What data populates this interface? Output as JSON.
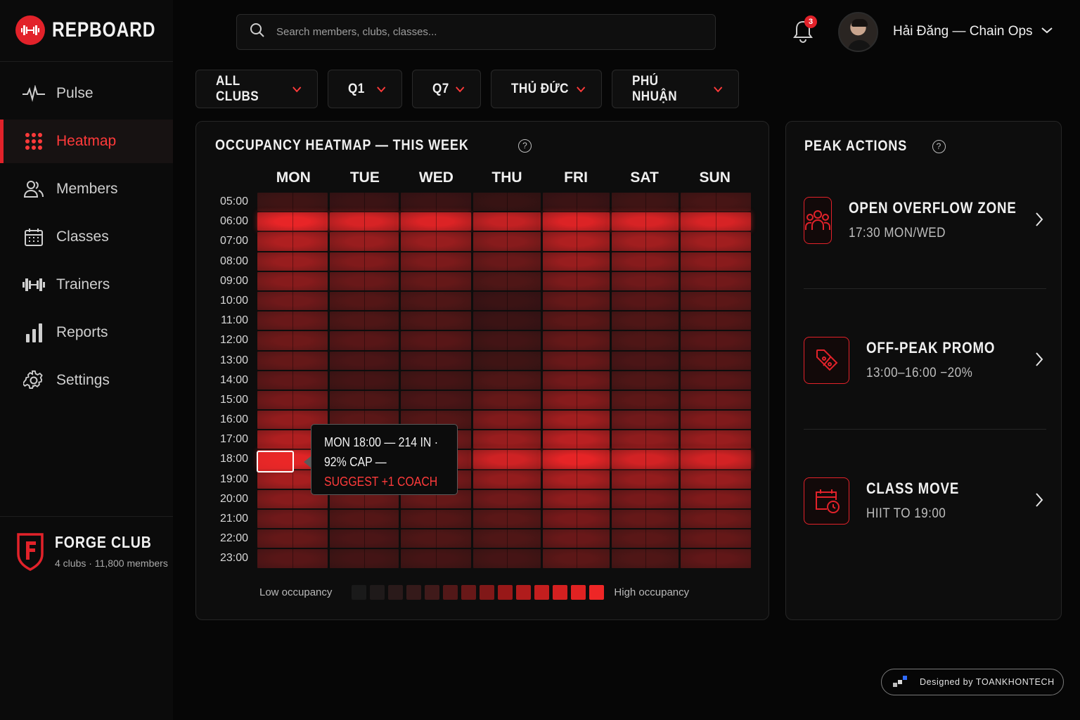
{
  "app": {
    "name": "REPBOARD",
    "logo_icon": "dumbbell-icon",
    "accent_color": "#e2222a"
  },
  "search": {
    "placeholder": "Search members, clubs, classes..."
  },
  "notifications": {
    "count": "3",
    "icon": "bell-icon"
  },
  "user": {
    "name": "Hải Đăng — Chain Ops"
  },
  "sidebar": {
    "items": [
      {
        "label": "Pulse",
        "icon": "pulse-icon",
        "active": false
      },
      {
        "label": "Heatmap",
        "icon": "grid-dots-icon",
        "active": true
      },
      {
        "label": "Members",
        "icon": "users-icon",
        "active": false
      },
      {
        "label": "Classes",
        "icon": "calendar-icon",
        "active": false
      },
      {
        "label": "Trainers",
        "icon": "dumbbell-icon",
        "active": false
      },
      {
        "label": "Reports",
        "icon": "bar-chart-icon",
        "active": false
      },
      {
        "label": "Settings",
        "icon": "gear-icon",
        "active": false
      }
    ],
    "club": {
      "name": "FORGE CLUB",
      "sub": "4 clubs · 11,800 members",
      "icon": "shield-f-icon"
    }
  },
  "filters": [
    {
      "label": "ALL CLUBS"
    },
    {
      "label": "Q1"
    },
    {
      "label": "Q7"
    },
    {
      "label": "THỦ ĐỨC"
    },
    {
      "label": "PHÚ NHUẬN"
    }
  ],
  "heatmap": {
    "title": "OCCUPANCY HEATMAP — THIS WEEK",
    "days": [
      "MON",
      "TUE",
      "WED",
      "THU",
      "FRI",
      "SAT",
      "SUN"
    ],
    "hours": [
      "05:00",
      "06:00",
      "07:00",
      "08:00",
      "09:00",
      "10:00",
      "11:00",
      "12:00",
      "13:00",
      "14:00",
      "15:00",
      "16:00",
      "17:00",
      "18:00",
      "19:00",
      "20:00",
      "21:00",
      "22:00",
      "23:00"
    ],
    "occupancy": [
      [
        0.22,
        0.95,
        0.72,
        0.62,
        0.55,
        0.45,
        0.42,
        0.44,
        0.4,
        0.38,
        0.48,
        0.6,
        0.72,
        0.92,
        0.68,
        0.55,
        0.45,
        0.4,
        0.34
      ],
      [
        0.2,
        0.88,
        0.62,
        0.52,
        0.42,
        0.32,
        0.3,
        0.34,
        0.28,
        0.25,
        0.3,
        0.35,
        0.48,
        0.62,
        0.5,
        0.4,
        0.32,
        0.28,
        0.24
      ],
      [
        0.2,
        0.9,
        0.62,
        0.5,
        0.4,
        0.3,
        0.3,
        0.34,
        0.28,
        0.25,
        0.28,
        0.32,
        0.45,
        0.6,
        0.48,
        0.4,
        0.32,
        0.3,
        0.25
      ],
      [
        0.18,
        0.8,
        0.55,
        0.42,
        0.3,
        0.2,
        0.2,
        0.24,
        0.22,
        0.3,
        0.4,
        0.52,
        0.62,
        0.85,
        0.6,
        0.45,
        0.35,
        0.3,
        0.25
      ],
      [
        0.2,
        0.9,
        0.72,
        0.62,
        0.5,
        0.4,
        0.36,
        0.4,
        0.42,
        0.46,
        0.55,
        0.66,
        0.76,
        0.94,
        0.7,
        0.58,
        0.48,
        0.42,
        0.36
      ],
      [
        0.22,
        0.88,
        0.66,
        0.55,
        0.45,
        0.34,
        0.3,
        0.3,
        0.28,
        0.3,
        0.36,
        0.45,
        0.58,
        0.86,
        0.6,
        0.48,
        0.4,
        0.35,
        0.3
      ],
      [
        0.26,
        0.88,
        0.66,
        0.56,
        0.46,
        0.36,
        0.32,
        0.34,
        0.32,
        0.34,
        0.42,
        0.52,
        0.62,
        0.86,
        0.62,
        0.52,
        0.44,
        0.4,
        0.38
      ]
    ],
    "tooltip": {
      "line1": "MON 18:00 — 214 IN ·",
      "line2": "92% CAP —",
      "line3": "SUGGEST +1 COACH"
    },
    "legend": {
      "low": "Low occupancy",
      "high": "High occupancy",
      "swatches": [
        "#1a1a1a",
        "#1f1a1a",
        "#2a1a1a",
        "#351a1a",
        "#401a1a",
        "#521818",
        "#681818",
        "#801818",
        "#981818",
        "#b01c1c",
        "#c41e1e",
        "#d42020",
        "#e02222",
        "#ee2626"
      ]
    }
  },
  "peak_actions": {
    "title": "PEAK ACTIONS",
    "items": [
      {
        "title": "OPEN OVERFLOW ZONE",
        "sub": "17:30 MON/WED",
        "icon": "group-icon"
      },
      {
        "title": "OFF-PEAK PROMO",
        "sub": "13:00–16:00 −20%",
        "icon": "discount-tag-icon"
      },
      {
        "title": "CLASS MOVE",
        "sub": "HIIT TO 19:00",
        "icon": "calendar-clock-icon"
      }
    ]
  },
  "credit": {
    "text": "Designed by TOANKHONTECH"
  }
}
